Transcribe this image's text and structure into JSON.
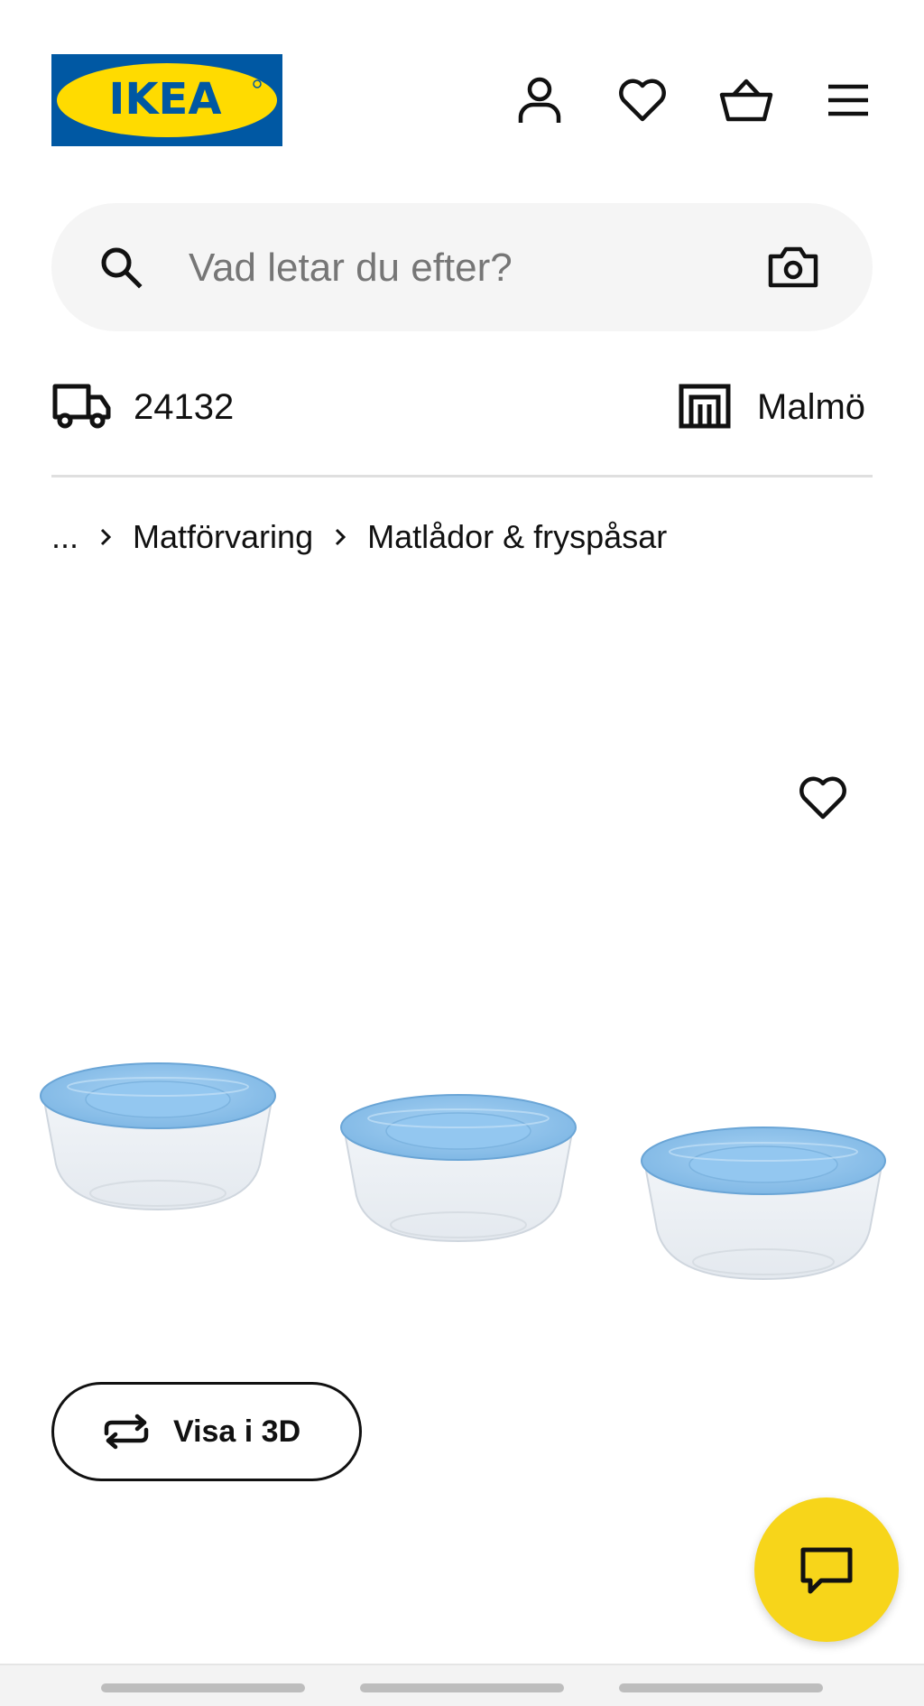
{
  "header": {
    "logo_text": "IKEA",
    "icons": [
      "user-icon",
      "heart-icon",
      "basket-icon",
      "menu-icon"
    ]
  },
  "search": {
    "placeholder": "Vad letar du efter?",
    "icons": [
      "search-icon",
      "camera-icon"
    ]
  },
  "delivery": {
    "postal_code": "24132",
    "icon": "truck-icon"
  },
  "store": {
    "name": "Malmö",
    "icon": "store-icon"
  },
  "breadcrumb": {
    "ellipsis": "...",
    "items": [
      "Matförvaring",
      "Matlådor & fryspåsar"
    ]
  },
  "product": {
    "favorite_icon": "heart-icon",
    "image": "three-food-containers-with-blue-lids"
  },
  "view3d": {
    "label": "Visa i 3D",
    "icon": "rotate-icon"
  },
  "chat": {
    "icon": "chat-icon"
  },
  "colors": {
    "brand_blue": "#0058a3",
    "brand_yellow": "#ffdb00",
    "chat_yellow": "#f7d51a",
    "lid_blue": "#8ec3ec",
    "search_bg": "#f5f5f5"
  }
}
